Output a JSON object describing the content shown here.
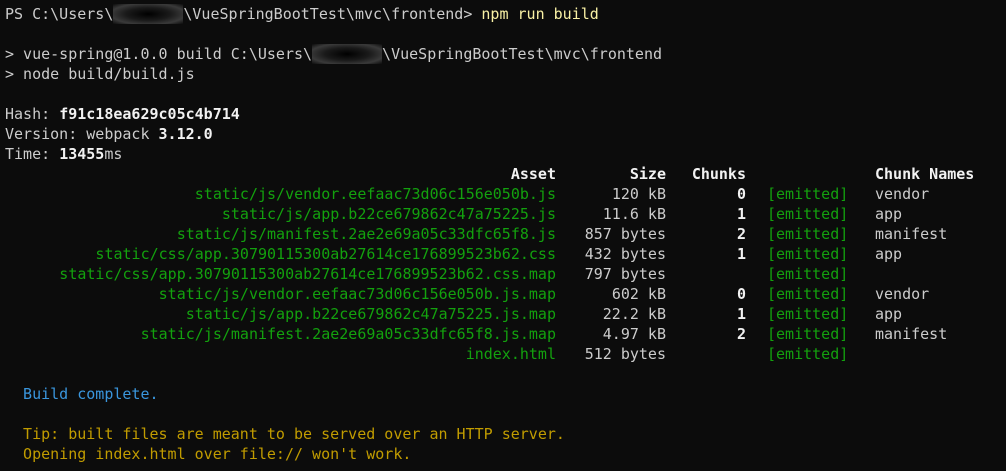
{
  "prompt": {
    "prefix": "PS C:\\Users\\",
    "path_suffix": "\\VueSpringBootTest\\mvc\\frontend> ",
    "command": "npm run build"
  },
  "script_lines": {
    "line1_prefix": "> vue-spring@1.0.0 build C:\\Users\\",
    "line1_suffix": "\\VueSpringBootTest\\mvc\\frontend",
    "line2": "> node build/build.js"
  },
  "stats": {
    "hash_label": "Hash: ",
    "hash_value": "f91c18ea629c05c4b714",
    "version_label": "Version: webpack ",
    "version_value": "3.12.0",
    "time_label": "Time: ",
    "time_value": "13455",
    "time_unit": "ms"
  },
  "table": {
    "headers": {
      "asset": "Asset",
      "size": "Size",
      "chunks": "Chunks",
      "chunk_names": "Chunk Names"
    },
    "rows": [
      {
        "asset": "static/js/vendor.eefaac73d06c156e050b.js",
        "size": "120 kB",
        "chunk": "0",
        "status": "[emitted]",
        "name": "vendor"
      },
      {
        "asset": "static/js/app.b22ce679862c47a75225.js",
        "size": "11.6 kB",
        "chunk": "1",
        "status": "[emitted]",
        "name": "app"
      },
      {
        "asset": "static/js/manifest.2ae2e69a05c33dfc65f8.js",
        "size": "857 bytes",
        "chunk": "2",
        "status": "[emitted]",
        "name": "manifest"
      },
      {
        "asset": "static/css/app.30790115300ab27614ce176899523b62.css",
        "size": "432 bytes",
        "chunk": "1",
        "status": "[emitted]",
        "name": "app"
      },
      {
        "asset": "static/css/app.30790115300ab27614ce176899523b62.css.map",
        "size": "797 bytes",
        "chunk": "",
        "status": "[emitted]",
        "name": ""
      },
      {
        "asset": "static/js/vendor.eefaac73d06c156e050b.js.map",
        "size": "602 kB",
        "chunk": "0",
        "status": "[emitted]",
        "name": "vendor"
      },
      {
        "asset": "static/js/app.b22ce679862c47a75225.js.map",
        "size": "22.2 kB",
        "chunk": "1",
        "status": "[emitted]",
        "name": "app"
      },
      {
        "asset": "static/js/manifest.2ae2e69a05c33dfc65f8.js.map",
        "size": "4.97 kB",
        "chunk": "2",
        "status": "[emitted]",
        "name": "manifest"
      },
      {
        "asset": "index.html",
        "size": "512 bytes",
        "chunk": "",
        "status": "[emitted]",
        "name": ""
      }
    ]
  },
  "messages": {
    "build_complete": "  Build complete.",
    "tip1": "  Tip: built files are meant to be served over an HTTP server.",
    "tip2": "  Opening index.html over file:// won't work."
  },
  "colors": {
    "background": "#0c0c0c",
    "text": "#cccccc",
    "asset_green": "#13a10e",
    "command_yellow": "#f9f1a5",
    "info_blue": "#3a96dd",
    "tip_yellow": "#c19c00"
  }
}
